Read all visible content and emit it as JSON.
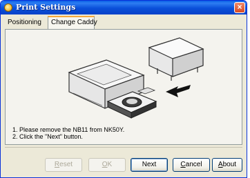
{
  "window": {
    "title": "Print Settings",
    "close_glyph": "×"
  },
  "tabs": [
    {
      "label": "Positioning",
      "selected": false
    },
    {
      "label": "Change Caddy",
      "selected": true
    }
  ],
  "instructions": [
    "1. Please remove the NB11 from NK50Y.",
    "2. Click the \"Next\" button."
  ],
  "buttons": {
    "reset": {
      "first": "R",
      "rest": "eset",
      "enabled": false
    },
    "ok": {
      "first": "O",
      "rest": "K",
      "enabled": false
    },
    "next": {
      "label": "Next",
      "enabled": true
    },
    "cancel": {
      "first": "C",
      "rest": "ancel",
      "enabled": true
    },
    "about": {
      "first": "A",
      "rest": "bout",
      "enabled": true
    }
  },
  "colors": {
    "titlebar": "#0a4fd9",
    "tab_highlight": "#f6a93c",
    "window_bg": "#ece9d8"
  },
  "icons": [
    "app-icon",
    "close-icon",
    "arrow-left-icon"
  ]
}
